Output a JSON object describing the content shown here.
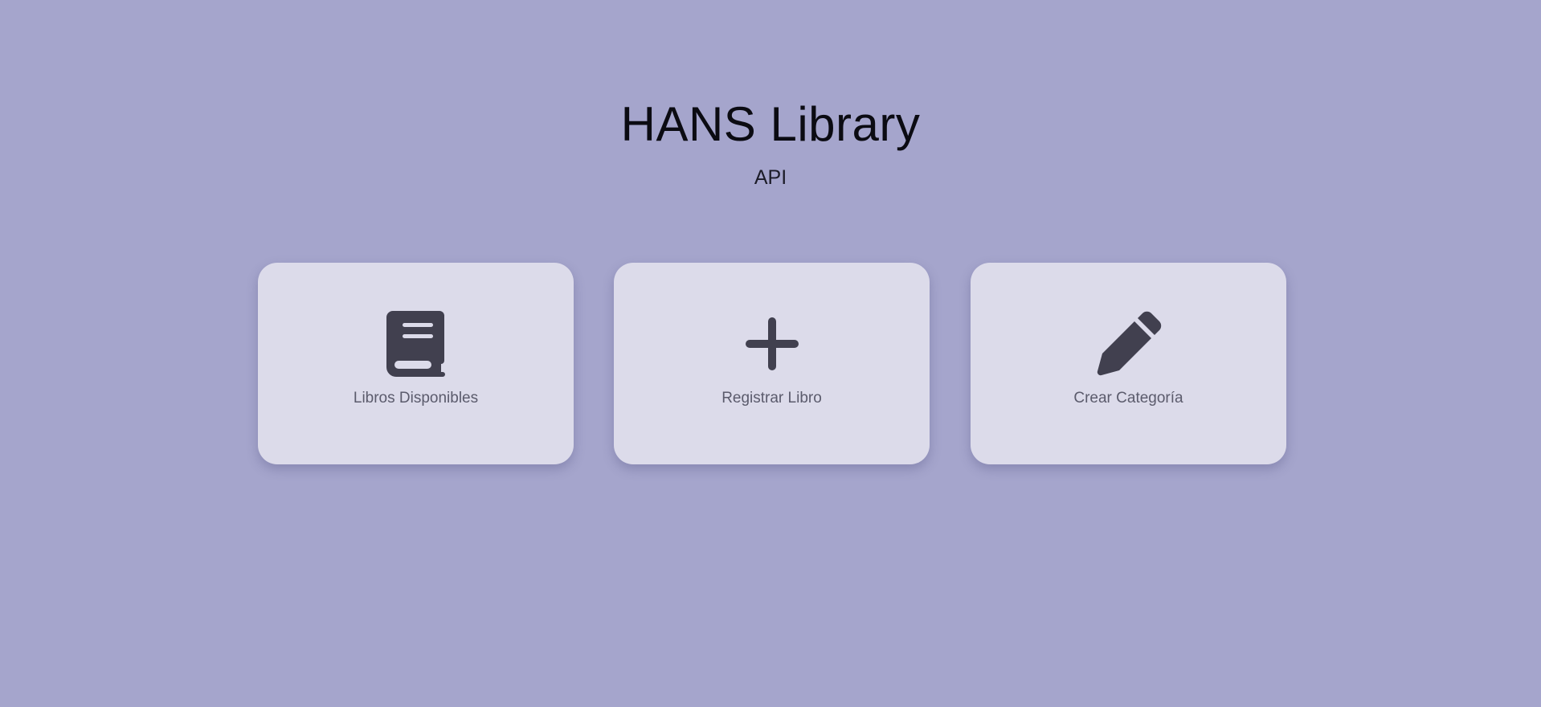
{
  "header": {
    "title": "HANS Library",
    "subtitle": "API"
  },
  "cards": [
    {
      "label": "Libros Disponibles",
      "icon": "book-icon"
    },
    {
      "label": "Registrar Libro",
      "icon": "plus-icon"
    },
    {
      "label": "Crear Categoría",
      "icon": "pencil-icon"
    }
  ],
  "colors": {
    "background": "#a5a5cc",
    "card": "#dcdbea",
    "icon": "#41404f",
    "label": "#5b5b6c",
    "title": "#0b0b12"
  }
}
